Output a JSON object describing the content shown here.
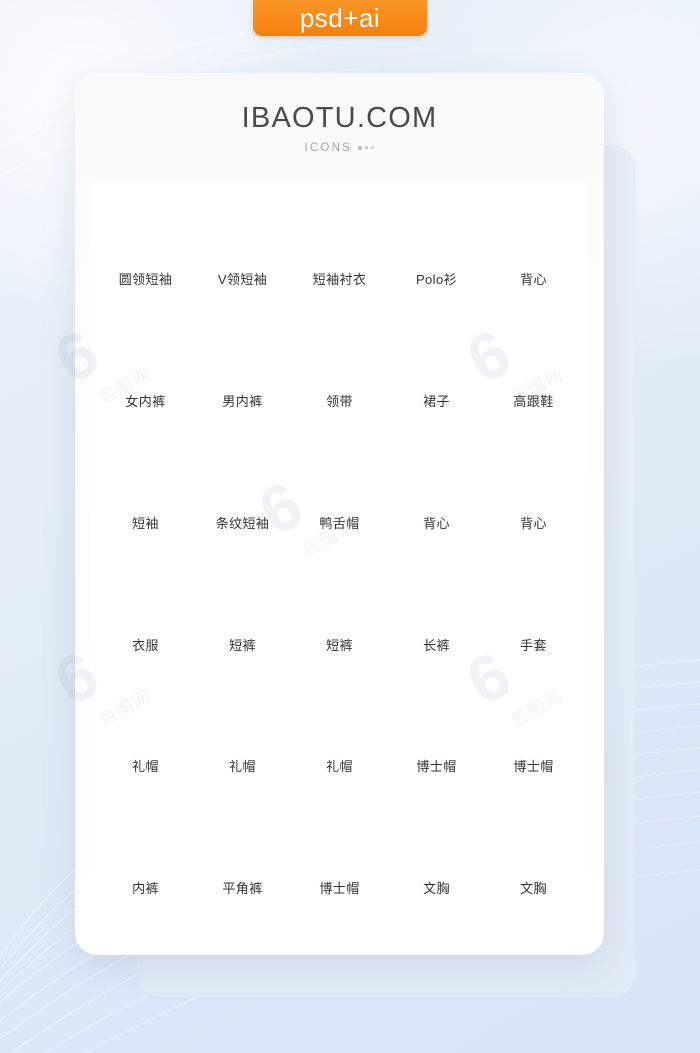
{
  "badge": {
    "label": "psd+ai"
  },
  "header": {
    "title": "IBAOTU.COM",
    "subtitle": "ICONS"
  },
  "colors": {
    "icon_blue": "#1B6EFF",
    "badge_orange": "#F5800C",
    "label_text": "#333333",
    "title_text": "#4A4A4A",
    "subtitle_text": "#A6A6A6",
    "card_white": "#FFFFFF",
    "card_back_blue": "#E3EDF8",
    "page_background": "#DCE8F6"
  },
  "watermark": {
    "text": "包图网",
    "mark": "6"
  },
  "grid": {
    "columns": 5,
    "rows": 6,
    "items": [
      {
        "label": "圆领短袖",
        "icon": "crew-neck-tshirt-icon"
      },
      {
        "label": "V领短袖",
        "icon": "v-neck-tshirt-icon"
      },
      {
        "label": "短袖衬衣",
        "icon": "short-sleeve-shirt-icon"
      },
      {
        "label": "Polo衫",
        "icon": "polo-shirt-icon"
      },
      {
        "label": "背心",
        "icon": "tank-top-icon"
      },
      {
        "label": "女内裤",
        "icon": "womens-briefs-icon"
      },
      {
        "label": "男内裤",
        "icon": "mens-briefs-icon"
      },
      {
        "label": "领带",
        "icon": "necktie-icon"
      },
      {
        "label": "裙子",
        "icon": "dress-icon"
      },
      {
        "label": "高跟鞋",
        "icon": "high-heel-shoe-icon"
      },
      {
        "label": "短袖",
        "icon": "star-tshirt-icon"
      },
      {
        "label": "条纹短袖",
        "icon": "striped-tshirt-icon"
      },
      {
        "label": "鸭舌帽",
        "icon": "baseball-cap-icon"
      },
      {
        "label": "背心",
        "icon": "tank-top-icon"
      },
      {
        "label": "背心",
        "icon": "tank-top-icon"
      },
      {
        "label": "衣服",
        "icon": "buttoned-shirt-icon"
      },
      {
        "label": "短裤",
        "icon": "shorts-icon"
      },
      {
        "label": "短裤",
        "icon": "cargo-shorts-icon"
      },
      {
        "label": "长裤",
        "icon": "trousers-icon"
      },
      {
        "label": "手套",
        "icon": "mittens-icon"
      },
      {
        "label": "礼帽",
        "icon": "top-hat-icon"
      },
      {
        "label": "礼帽",
        "icon": "bowler-hat-icon"
      },
      {
        "label": "礼帽",
        "icon": "round-hat-icon"
      },
      {
        "label": "博士帽",
        "icon": "graduation-cap-icon"
      },
      {
        "label": "博士帽",
        "icon": "graduation-cap-tassel-icon"
      },
      {
        "label": "内裤",
        "icon": "mens-underwear-icon"
      },
      {
        "label": "平角裤",
        "icon": "boxer-briefs-icon"
      },
      {
        "label": "博士帽",
        "icon": "womens-panties-icon"
      },
      {
        "label": "文胸",
        "icon": "bra-icon"
      },
      {
        "label": "文胸",
        "icon": "bra-alt-icon"
      }
    ]
  }
}
